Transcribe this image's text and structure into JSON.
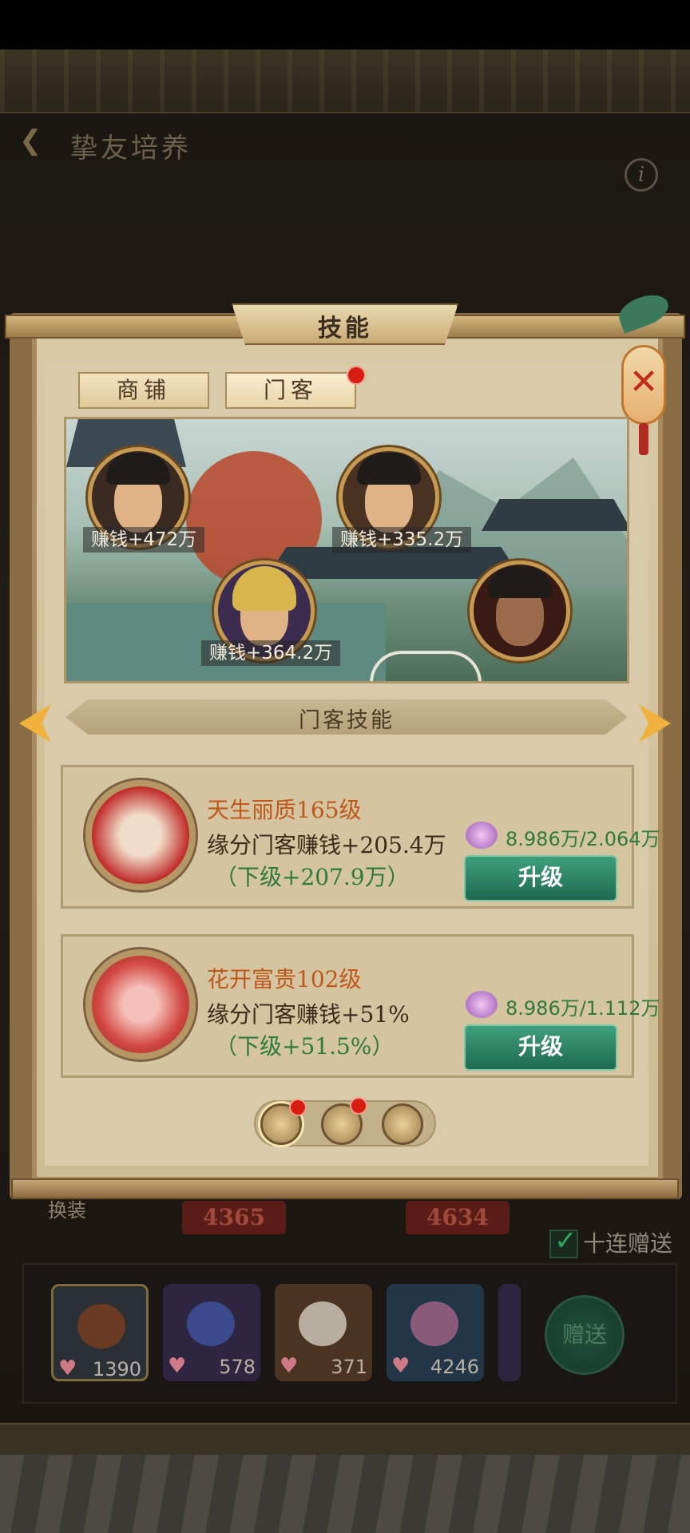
{
  "header": {
    "title": "挚友培养",
    "back_icon": "chevron-left-icon",
    "info_icon": "info-icon",
    "info_glyph": "i"
  },
  "background": {
    "equip_label": "换装",
    "value_1": "4365",
    "value_2": "4634",
    "ten_gift_label": "十连赠送",
    "ten_gift_checked": true
  },
  "gifts": [
    {
      "icon": "comb-icon",
      "count": "1390"
    },
    {
      "icon": "hairpin-icon",
      "count": "578"
    },
    {
      "icon": "earring-icon",
      "count": "371"
    },
    {
      "icon": "rouge-box-icon",
      "count": "4246"
    }
  ],
  "give_button": "赠送",
  "panel": {
    "title": "技能",
    "close_glyph": "✕",
    "tabs": [
      {
        "label": "商铺",
        "active": false
      },
      {
        "label": "门客",
        "active": true,
        "badge": true
      }
    ],
    "retainers": [
      {
        "earn": "赚钱+472万"
      },
      {
        "earn": "赚钱+335.2万"
      },
      {
        "earn": "赚钱+364.2万"
      },
      {
        "earn": ""
      }
    ],
    "section_title": "门客技能",
    "skills": [
      {
        "name": "天生丽质165级",
        "effect": "缘分门客赚钱+205.4万",
        "next": "（下级+207.9万）",
        "cost": "8.986万/2.064万",
        "button": "升级"
      },
      {
        "name": "花开富贵102级",
        "effect": "缘分门客赚钱+51%",
        "next": "（下级+51.5%）",
        "cost": "8.986万/1.112万",
        "button": "升级"
      }
    ],
    "pages": {
      "total": 3,
      "current": 1,
      "badges": [
        true,
        true,
        false
      ]
    }
  },
  "colors": {
    "accent_green": "#2e7a3a",
    "skill_name": "#c0571c",
    "button_green": "#1e6a50",
    "badge_red": "#d81e12"
  }
}
